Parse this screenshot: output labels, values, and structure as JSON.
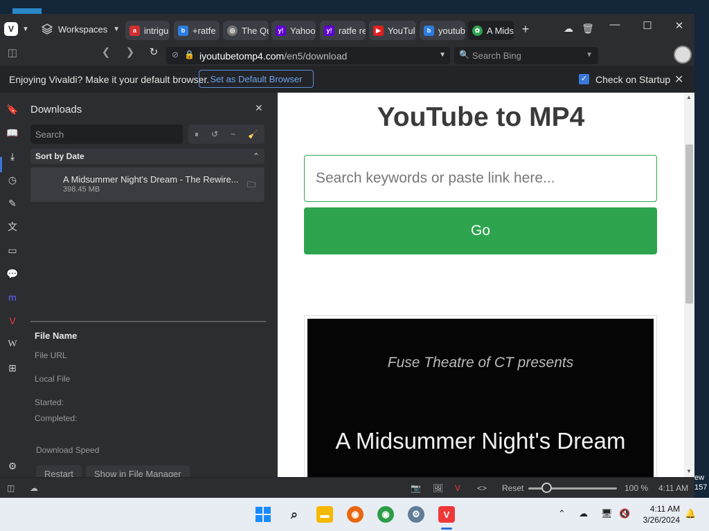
{
  "desktop": {
    "right_edge_text": [
      "ew",
      "157"
    ]
  },
  "titlebar": {
    "workspaces_label": "Workspaces",
    "tabs": [
      {
        "label": "intrigu",
        "favicon": "ask-icon",
        "color": "#d0302f"
      },
      {
        "label": "+ratfe",
        "favicon": "bing-icon",
        "color": "#2b7de0"
      },
      {
        "label": "The Qu",
        "favicon": "globe-icon",
        "color": "#777777"
      },
      {
        "label": "Yahoo",
        "favicon": "yahoo-icon",
        "color": "#6001d2"
      },
      {
        "label": "ratfe re",
        "favicon": "yahoo-icon",
        "color": "#6001d2"
      },
      {
        "label": "YouTul",
        "favicon": "youtube-icon",
        "color": "#e02020"
      },
      {
        "label": "youtub",
        "favicon": "bing-icon",
        "color": "#2b7de0"
      },
      {
        "label": "A Mids",
        "favicon": "cloud-app-icon",
        "color": "#2ea44f",
        "active": true
      }
    ]
  },
  "address": {
    "url_host": "iyoutubetomp4.com",
    "url_path": "/en5/download",
    "search_placeholder": "Search Bing"
  },
  "notification": {
    "message": "Enjoying Vivaldi? Make it your default browser.",
    "default_button": "Set as Default Browser",
    "check_label": "Check on Startup"
  },
  "downloads": {
    "title": "Downloads",
    "search_placeholder": "Search",
    "sort_label": "Sort by Date",
    "items": [
      {
        "name": "A Midsummer Night's Dream - The Rewire...",
        "size": "398.45 MB"
      }
    ],
    "detail": {
      "file_name": "File Name",
      "file_url": "File URL",
      "local_file": "Local File",
      "started": "Started:",
      "completed": "Completed:",
      "download_speed": "Download Speed",
      "restart": "Restart",
      "show_in_manager": "Show in File Manager"
    }
  },
  "page": {
    "title": "YouTube to MP4",
    "input_placeholder": "Search keywords or paste link here...",
    "go_label": "Go",
    "video_subtitle": "Fuse Theatre of CT presents",
    "video_title": "A Midsummer Night's Dream"
  },
  "statusbar": {
    "reset_label": "Reset",
    "zoom_level": "100 %",
    "time": "4:11 AM",
    "zoom_fraction": 0.2
  },
  "taskbar": {
    "time": "4:11 AM",
    "date": "3/26/2024"
  },
  "colors": {
    "accent": "#3a78d8",
    "go_green": "#2ea44f"
  }
}
